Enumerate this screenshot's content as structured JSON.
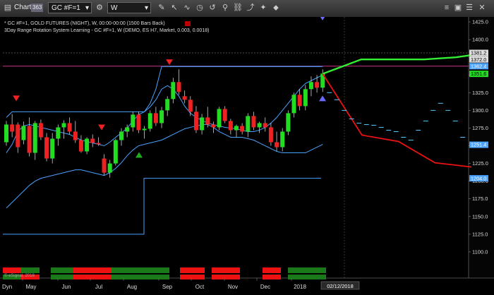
{
  "toolbar": {
    "chart_label": "Chart",
    "chart_badge": "363",
    "symbol": "GC #F=1",
    "interval": "W"
  },
  "header_lines": [
    "* GC #F=1, GOLD FUTURES (NIGHT), W, 00:00-00:00 (1500 Bars Back)",
    "3Day Range Rotation System Learning - GC #F=1, W (DEMO, ES H7, Market, 0.003, 0.0018)"
  ],
  "copyright": "© eSignal, 2018",
  "footer": {
    "left_label": "Dyn",
    "cursor_date": "02/12/2018"
  },
  "colors": {
    "up": "#22dd22",
    "down": "#ee2222",
    "band": "#4aa3ff",
    "magenta": "#cc3388",
    "projection": "#55ccff"
  },
  "chart_data": {
    "type": "candlestick",
    "y_range": [
      1085,
      1432
    ],
    "y_ticks": [
      1100.0,
      1125.0,
      1150.0,
      1175.0,
      1200.0,
      1225.0,
      1250.0,
      1275.0,
      1300.0,
      1325.0,
      1350.0,
      1375.0,
      1400.0,
      1425.0
    ],
    "x_ticks": [
      "May",
      "Jun",
      "Jul",
      "Aug",
      "Sep",
      "Oct",
      "Nov",
      "Dec",
      "2018"
    ],
    "price_tags": [
      {
        "value": 1381.2,
        "label": "1381.2",
        "color": "#dddddd",
        "text": "#000000"
      },
      {
        "value": 1372.0,
        "label": "1372.0",
        "color": "#dddddd",
        "text": "#000000"
      },
      {
        "value": 1362.4,
        "label": "1362.4",
        "color": "#4aa3ff",
        "text": "#ffffff"
      },
      {
        "value": 1351.6,
        "label": "1351.6",
        "color": "#22dd22",
        "text": "#000000"
      },
      {
        "value": 1251.4,
        "label": "1251.4",
        "color": "#4aa3ff",
        "text": "#ffffff"
      },
      {
        "value": 1204.0,
        "label": "1204.0",
        "color": "#4aa3ff",
        "text": "#ffffff"
      }
    ],
    "candles": [
      [
        1255,
        1285,
        1250,
        1280
      ],
      [
        1280,
        1295,
        1262,
        1270
      ],
      [
        1280,
        1283,
        1240,
        1248
      ],
      [
        1258,
        1284,
        1252,
        1278
      ],
      [
        1278,
        1290,
        1235,
        1240
      ],
      [
        1240,
        1285,
        1230,
        1282
      ],
      [
        1282,
        1287,
        1258,
        1262
      ],
      [
        1262,
        1268,
        1228,
        1232
      ],
      [
        1232,
        1268,
        1225,
        1260
      ],
      [
        1260,
        1280,
        1250,
        1276
      ],
      [
        1276,
        1286,
        1260,
        1282
      ],
      [
        1282,
        1290,
        1266,
        1270
      ],
      [
        1270,
        1285,
        1254,
        1258
      ],
      [
        1258,
        1265,
        1240,
        1242
      ],
      [
        1242,
        1262,
        1238,
        1260
      ],
      [
        1260,
        1266,
        1248,
        1254
      ],
      [
        1254,
        1262,
        1250,
        1252
      ],
      [
        1232,
        1238,
        1208,
        1212
      ],
      [
        1212,
        1230,
        1205,
        1225
      ],
      [
        1225,
        1260,
        1222,
        1258
      ],
      [
        1258,
        1275,
        1250,
        1270
      ],
      [
        1270,
        1280,
        1262,
        1276
      ],
      [
        1276,
        1298,
        1270,
        1294
      ],
      [
        1294,
        1298,
        1268,
        1272
      ],
      [
        1272,
        1278,
        1260,
        1274
      ],
      [
        1274,
        1300,
        1270,
        1296
      ],
      [
        1296,
        1305,
        1278,
        1282
      ],
      [
        1282,
        1305,
        1275,
        1300
      ],
      [
        1300,
        1320,
        1292,
        1316
      ],
      [
        1316,
        1346,
        1310,
        1340
      ],
      [
        1340,
        1358,
        1322,
        1326
      ],
      [
        1320,
        1328,
        1310,
        1315
      ],
      [
        1315,
        1320,
        1292,
        1298
      ],
      [
        1298,
        1306,
        1268,
        1272
      ],
      [
        1272,
        1295,
        1266,
        1290
      ],
      [
        1290,
        1305,
        1276,
        1280
      ],
      [
        1280,
        1284,
        1268,
        1276
      ],
      [
        1276,
        1305,
        1272,
        1302
      ],
      [
        1302,
        1306,
        1282,
        1285
      ],
      [
        1285,
        1288,
        1266,
        1272
      ],
      [
        1272,
        1280,
        1262,
        1278
      ],
      [
        1278,
        1282,
        1266,
        1270
      ],
      [
        1270,
        1296,
        1262,
        1292
      ],
      [
        1292,
        1298,
        1272,
        1276
      ],
      [
        1276,
        1284,
        1268,
        1282
      ],
      [
        1282,
        1290,
        1270,
        1276
      ],
      [
        1276,
        1282,
        1250,
        1255
      ],
      [
        1255,
        1270,
        1242,
        1248
      ],
      [
        1248,
        1275,
        1242,
        1270
      ],
      [
        1270,
        1300,
        1265,
        1296
      ],
      [
        1296,
        1325,
        1290,
        1322
      ],
      [
        1322,
        1330,
        1300,
        1306
      ],
      [
        1306,
        1336,
        1300,
        1330
      ],
      [
        1330,
        1348,
        1320,
        1340
      ],
      [
        1340,
        1350,
        1325,
        1332
      ],
      [
        1332,
        1358,
        1326,
        1352
      ]
    ],
    "band_upper": [
      1290,
      1298,
      1298,
      1298,
      1298,
      1298,
      1298,
      1298,
      1298,
      1298,
      1298,
      1298,
      1298,
      1298,
      1298,
      1298,
      1298,
      1298,
      1298,
      1298,
      1298,
      1298,
      1298,
      1298,
      1298,
      1310,
      1330,
      1362,
      1362,
      1362,
      1362,
      1362,
      1362,
      1362,
      1362,
      1362,
      1362,
      1362,
      1362,
      1362,
      1362,
      1362,
      1362,
      1362,
      1362,
      1362,
      1362,
      1362,
      1362,
      1362,
      1362,
      1362,
      1362,
      1362,
      1362,
      1362
    ],
    "band_mid": [
      1240,
      1252,
      1270,
      1278,
      1280,
      1278,
      1276,
      1274,
      1272,
      1270,
      1268,
      1266,
      1262,
      1258,
      1256,
      1254,
      1252,
      1250,
      1255,
      1262,
      1268,
      1275,
      1285,
      1294,
      1298,
      1305,
      1315,
      1330,
      1335,
      1330,
      1320,
      1306,
      1296,
      1290,
      1286,
      1282,
      1280,
      1278,
      1276,
      1275,
      1274,
      1272,
      1270,
      1270,
      1272,
      1276,
      1282,
      1290,
      1300,
      1310,
      1320,
      1330,
      1338,
      1342,
      1346,
      1350
    ],
    "band_lower": [
      1162,
      1170,
      1178,
      1186,
      1194,
      1200,
      1204,
      1206,
      1208,
      1210,
      1212,
      1214,
      1216,
      1216,
      1214,
      1212,
      1210,
      1208,
      1212,
      1218,
      1226,
      1236,
      1244,
      1250,
      1252,
      1254,
      1256,
      1258,
      1262,
      1266,
      1270,
      1274,
      1276,
      1278,
      1280,
      1280,
      1276,
      1270,
      1266,
      1262,
      1262,
      1262,
      1260,
      1258,
      1254,
      1250,
      1246,
      1242,
      1240,
      1240,
      1240,
      1240,
      1240,
      1244,
      1248,
      1252
    ],
    "support_step": {
      "pre": 1125,
      "post": 1204
    },
    "magenta_level": 1362.4,
    "green_projection": [
      1351.6,
      1372,
      1372,
      1372,
      1375,
      1381.2
    ],
    "red_projection": [
      1351.6,
      1265,
      1256,
      1226,
      1220
    ],
    "projection_dashes": [
      1325,
      1315,
      1300,
      1288,
      1282,
      1280,
      1279,
      1276,
      1272,
      1270,
      1262,
      1258,
      1272,
      1285,
      1300,
      1310,
      1300,
      1285,
      1262
    ],
    "sell_markers": [
      1316,
      1275,
      1276,
      1367
    ],
    "buy_markers": [
      1262,
      1285
    ],
    "blue_markers": [
      1430,
      1320
    ],
    "histogram": [
      {
        "i": 0,
        "top": "r",
        "bot": "g"
      },
      {
        "i": 1,
        "top": "g",
        "bot": "g"
      },
      {
        "i": 2,
        "top": "g",
        "bot": "r"
      },
      {
        "i": 3,
        "top": "g",
        "bot": "g"
      },
      {
        "i": 4,
        "top": "r",
        "bot": "r"
      },
      {
        "i": 5,
        "top": "g",
        "bot": "g"
      },
      {
        "i": 6,
        "top": "r",
        "bot": "g"
      },
      {
        "i": 7,
        "top": "g",
        "bot": "g"
      }
    ]
  }
}
